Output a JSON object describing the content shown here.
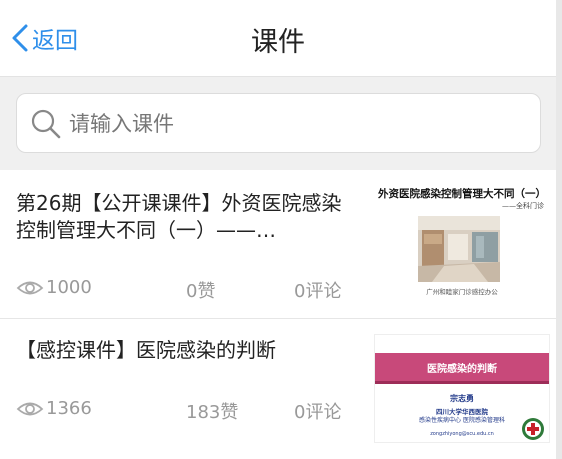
{
  "header": {
    "back_label": "返回",
    "title": "课件"
  },
  "search": {
    "placeholder": "请输入课件",
    "value": ""
  },
  "courses": [
    {
      "title": "第26期【公开课课件】外资医院感染控制管理大不同（一）——…",
      "views": "1000",
      "likes": "0赞",
      "comments": "0评论",
      "thumbnail": {
        "title": "外资医院感染控制管理大不同（一）",
        "subtitle": "——全科门诊",
        "footer": "广州和睦家门诊感控办公"
      }
    },
    {
      "title": "【感控课件】医院感染的判断",
      "views": "1366",
      "likes": "183赞",
      "comments": "0评论",
      "thumbnail": {
        "title": "医院感染的判断",
        "name": "宗志勇",
        "org_line1": "四川大学华西医院",
        "org_line2": "感染性疾病中心 医院感染管理科",
        "email": "zongzhiyong@scu.edu.cn"
      }
    }
  ],
  "colors": {
    "accent": "#2f8fea",
    "search_bg": "#f0f0f0",
    "slide_band": "#c8497a"
  },
  "icons": {
    "back": "chevron-left-icon",
    "search": "magnifier-icon",
    "views": "eye-icon"
  }
}
